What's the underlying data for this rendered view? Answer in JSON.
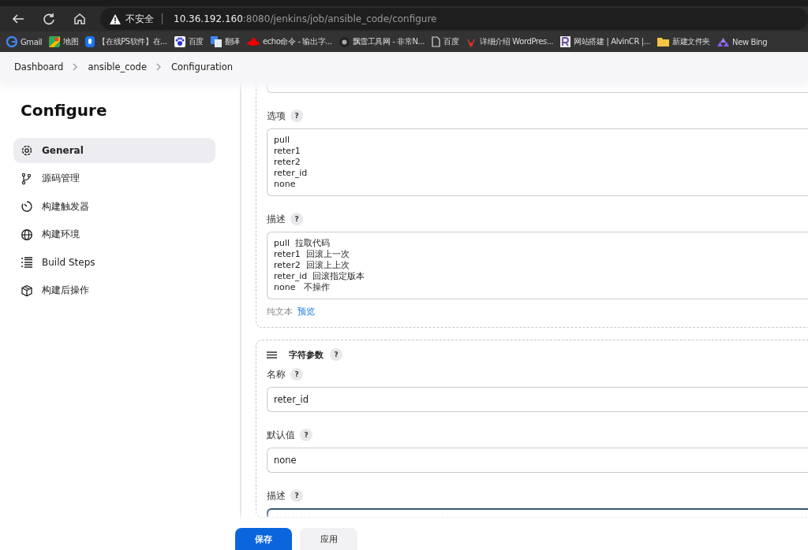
{
  "browser": {
    "security": "不安全",
    "url_host": "10.36.192.160",
    "url_rest": ":8080/jenkins/job/ansible_code/configure",
    "bookmarks": [
      {
        "label": "Gmail",
        "kind": "g"
      },
      {
        "label": "地图",
        "kind": "map"
      },
      {
        "label": "【在线PS软件】在...",
        "kind": "ps"
      },
      {
        "label": "百度",
        "kind": "paw"
      },
      {
        "label": "翻译",
        "kind": "translate"
      },
      {
        "label": "echo命令 - 输出字...",
        "kind": "hat"
      },
      {
        "label": "飘雪工具网 - 非常N...",
        "kind": "dark"
      },
      {
        "label": "百度",
        "kind": "page"
      },
      {
        "label": "详细介绍 WordPres...",
        "kind": "wp"
      },
      {
        "label": "网站搭建 | AlvinCR |...",
        "kind": "r"
      },
      {
        "label": "新建文件夹",
        "kind": "folder"
      },
      {
        "label": "New Bing",
        "kind": "bing"
      }
    ]
  },
  "breadcrumbs": [
    "Dashboard",
    "ansible_code",
    "Configuration"
  ],
  "sidebar": {
    "title": "Configure",
    "items": [
      {
        "label": "General",
        "selected": true
      },
      {
        "label": "源码管理",
        "selected": false
      },
      {
        "label": "构建触发器",
        "selected": false
      },
      {
        "label": "构建环境",
        "selected": false
      },
      {
        "label": "Build Steps",
        "selected": false
      },
      {
        "label": "构建后操作",
        "selected": false
      }
    ]
  },
  "choice_param": {
    "options_help": "?",
    "description_help": "?",
    "options_label": "选项",
    "options": [
      "pull",
      "reter1",
      "reter2",
      "reter_id",
      "none"
    ],
    "description_label": "描述",
    "description": [
      "pull  拉取代码",
      "reter1  回滚上一次",
      "reter2  回滚上上次",
      "reter_id  回滚指定版本",
      "none   不操作"
    ],
    "plain_text": "纯文本",
    "preview": "预览"
  },
  "string_param": {
    "title_help": "?",
    "name_help": "?",
    "default_help": "?",
    "description_help": "?",
    "title": "字符参数",
    "name_label": "名称",
    "name": "reter_id",
    "default_label": "默认值",
    "default": "none",
    "description_label": "描述"
  },
  "buttons": {
    "save": "保存",
    "apply": "应用"
  }
}
